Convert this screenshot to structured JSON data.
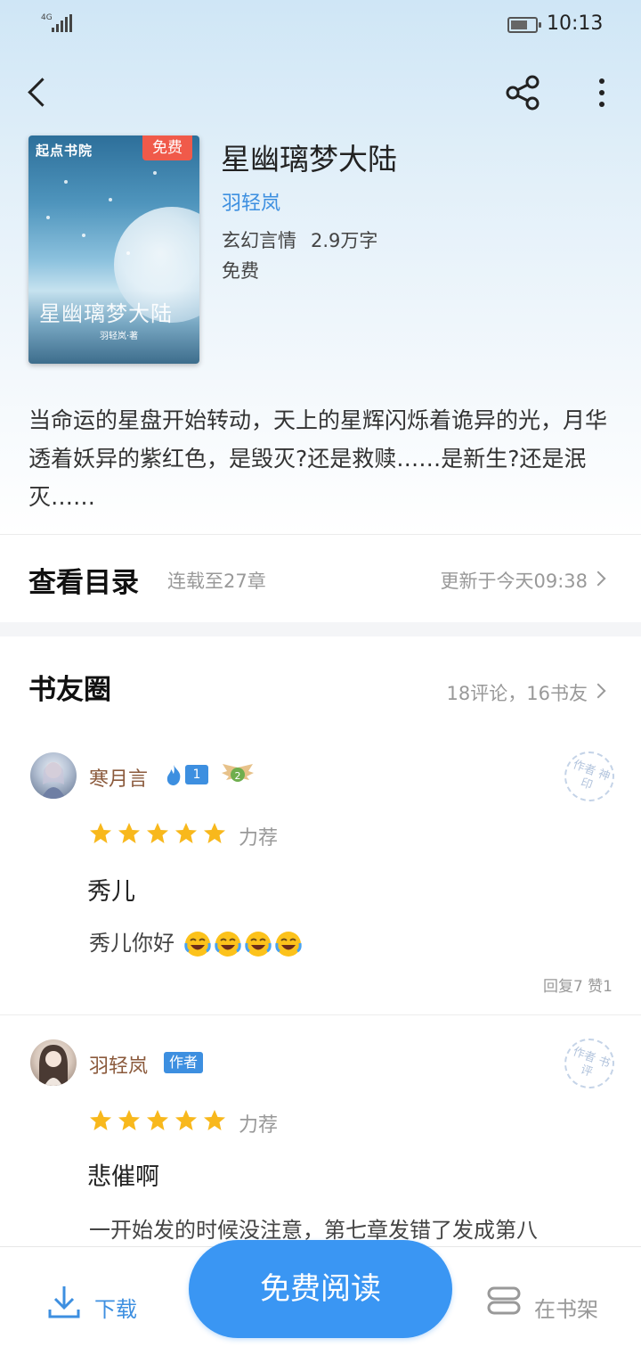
{
  "status_bar": {
    "signal_label": "4G",
    "time": "10:13"
  },
  "cover": {
    "logo": "起点书院",
    "free_badge": "免费",
    "title": "星幽璃梦大陆",
    "author": "羽轻岚·著"
  },
  "book": {
    "title": "星幽璃梦大陆",
    "author": "羽轻岚",
    "genre": "玄幻言情",
    "word_count": "2.9万字",
    "price": "免费",
    "description": "当命运的星盘开始转动，天上的星辉闪烁着诡异的光，月华透着妖异的紫红色，是毁灭?还是救赎……是新生?还是泯灭……"
  },
  "toc": {
    "label": "查看目录",
    "status": "连载至27章",
    "updated": "更新于今天09:38"
  },
  "circle": {
    "title": "书友圈",
    "summary": "18评论，16书友"
  },
  "comments": [
    {
      "username": "寒月言",
      "level": "1",
      "wing_level": "2",
      "stamp": "作者 神印",
      "rating": 5,
      "rating_label": "力荐",
      "title": "秀儿",
      "body": "秀儿你好",
      "emoji_count": 4,
      "stats": "回复7  赞1"
    },
    {
      "username": "羽轻岚",
      "badge": "作者",
      "stamp": "作者 书评",
      "rating": 5,
      "rating_label": "力荐",
      "title": "悲催啊",
      "body": "一开始发的时候没注意，第七章发错了发成第八"
    }
  ],
  "bottom_bar": {
    "download": "下载",
    "read": "免费阅读",
    "shelf": "在书架"
  },
  "colors": {
    "accent": "#3a96f3",
    "star": "#f8b81c",
    "link": "#3d8fe0"
  }
}
